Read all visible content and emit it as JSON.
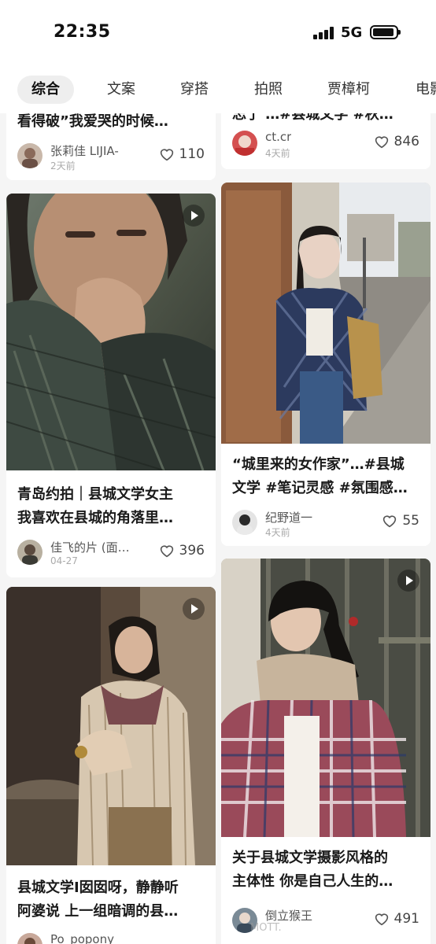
{
  "status_bar": {
    "time": "22:35",
    "network": "5G"
  },
  "tabs": [
    {
      "label": "综合",
      "active": true
    },
    {
      "label": "文案"
    },
    {
      "label": "穿搭"
    },
    {
      "label": "拍照"
    },
    {
      "label": "贾樟柯"
    },
    {
      "label": "电影"
    }
  ],
  "cards": [
    {
      "title": "看得破”我爱哭的时候…",
      "author": "张莉佳 LIJIA-",
      "date": "2天前",
      "likes": "110"
    },
    {
      "title": "忘了 …#县城文学 #秋…",
      "author": "ct.cr",
      "date": "4天前",
      "likes": "846"
    },
    {
      "title": "青岛约拍｜县城文学女主\n我喜欢在县城的角落里…",
      "author": "佳飞的片 (面…",
      "date": "04-27",
      "likes": "396"
    },
    {
      "title": "“城里来的女作家”…#县城\n文学 #笔记灵感 #氛围感…",
      "author": "纪野道一",
      "date": "4天前",
      "likes": "55"
    },
    {
      "title": "县城文学I囡囡呀，静静听\n阿婆说 上一组暗调的县…",
      "author": "Po_popony",
      "date": "",
      "likes": ""
    },
    {
      "title": "关于县城文学摄影风格的\n主体性 你是自己人生的…",
      "author": "倒立猴王",
      "date": "",
      "likes": "491"
    }
  ],
  "watermark": "MOTT."
}
